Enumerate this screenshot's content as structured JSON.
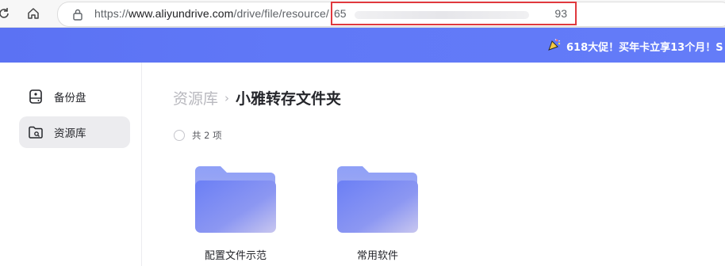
{
  "browser": {
    "url_prefix": "https://",
    "url_domain": "www.aliyundrive.com",
    "url_path": "/drive/file/resource/",
    "url_id_start": "65",
    "url_id_end": "93"
  },
  "promo": {
    "text": "618大促！买年卡立享13个月！S"
  },
  "sidebar": {
    "items": [
      {
        "label": "备份盘",
        "icon": "backup-drive-icon",
        "active": false
      },
      {
        "label": "资源库",
        "icon": "resource-folder-icon",
        "active": true
      }
    ]
  },
  "main": {
    "breadcrumb": {
      "root": "资源库",
      "separator": "›",
      "current": "小雅转存文件夹"
    },
    "count_text": "共 2 项",
    "folders": [
      {
        "name": "配置文件示范"
      },
      {
        "name": "常用软件"
      }
    ]
  },
  "colors": {
    "accent": "#6078f7",
    "highlight_box": "#e0393e",
    "sidebar_active": "#ececef"
  }
}
